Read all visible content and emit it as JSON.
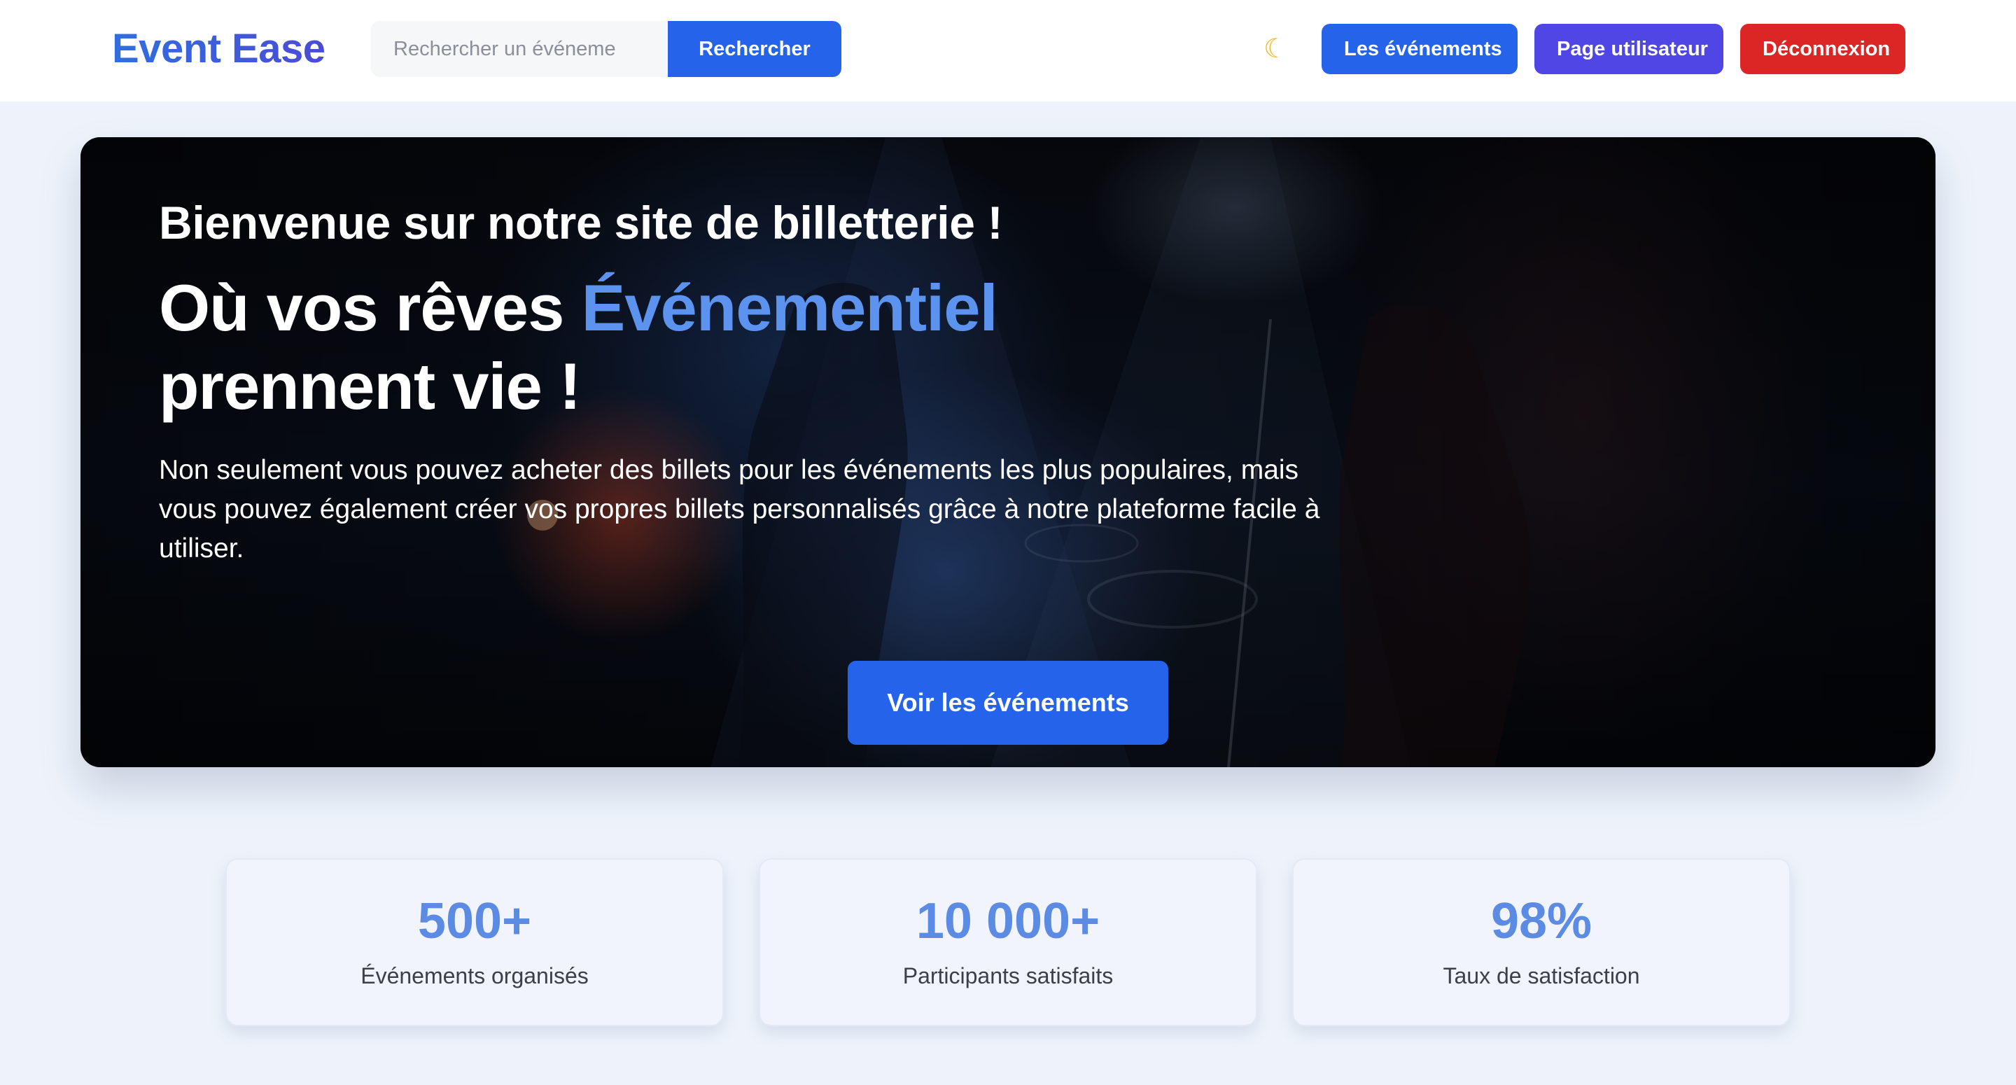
{
  "header": {
    "logo": "Event Ease",
    "search_placeholder": "Rechercher un événeme",
    "search_button": "Rechercher",
    "theme_icon": "moon-icon",
    "nav": {
      "events": "Les événements",
      "user_page": "Page utilisateur",
      "logout": "Déconnexion"
    }
  },
  "hero": {
    "kicker": "Bienvenue sur notre site de billetterie !",
    "title_start": "Où vos rêves ",
    "title_accent": "Événementiel",
    "title_end": "prennent vie !",
    "description": "Non seulement vous pouvez acheter des billets pour les événements les plus populaires, mais vous pouvez également créer vos propres billets personnalisés grâce à notre plateforme facile à utiliser.",
    "cta": "Voir les événements"
  },
  "stats": [
    {
      "value": "500+",
      "label": "Événements organisés"
    },
    {
      "value": "10 000+",
      "label": "Participants satisfaits"
    },
    {
      "value": "98%",
      "label": "Taux de satisfaction"
    }
  ],
  "colors": {
    "primary": "#2563eb",
    "indigo": "#4f46e5",
    "danger": "#dc2626",
    "accent_text": "#5b93ef",
    "page_bg": "#eef3fb"
  }
}
